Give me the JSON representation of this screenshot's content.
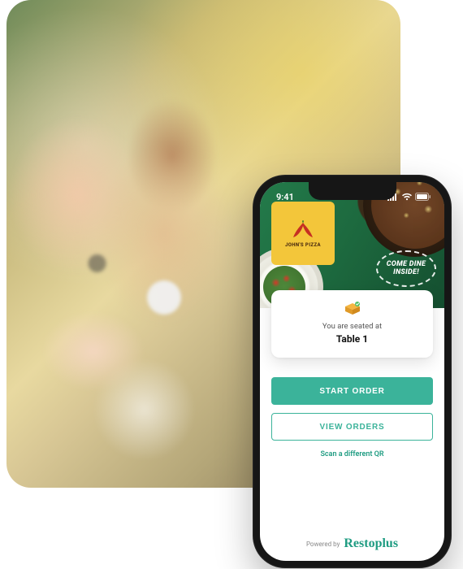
{
  "statusbar": {
    "time": "9:41"
  },
  "hero": {
    "restaurant_name": "John's Pizza",
    "badge_text": "COME DINE INSIDE!"
  },
  "card": {
    "seated_label": "You are seated at",
    "table_name": "Table 1"
  },
  "buttons": {
    "start_order": "START ORDER",
    "view_orders": "VIEW ORDERS",
    "scan_different": "Scan a different QR"
  },
  "footer": {
    "powered_by": "Powered by",
    "brand": "Restoplus"
  },
  "colors": {
    "accent": "#3bb39a",
    "hero_green": "#1d6a3f",
    "logo_yellow": "#f3c63a"
  }
}
